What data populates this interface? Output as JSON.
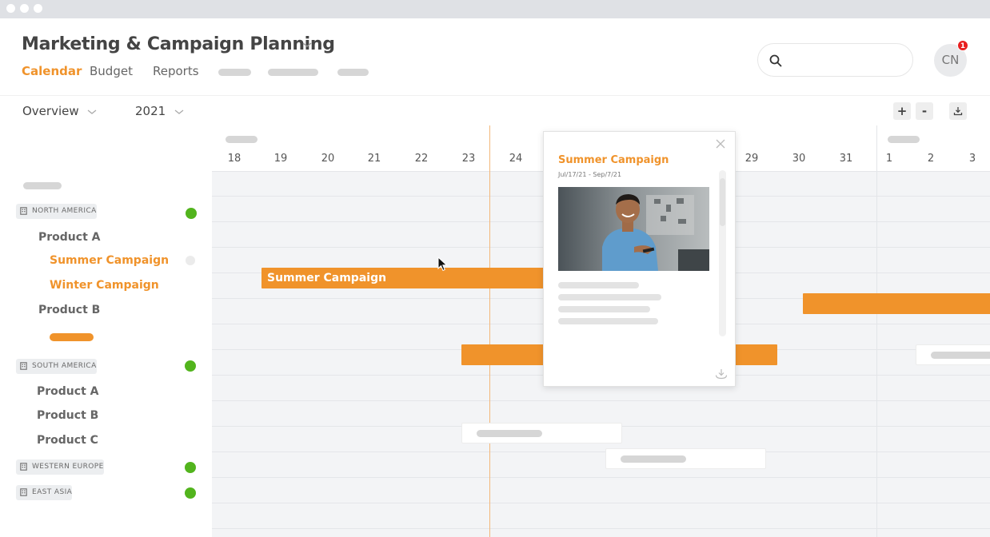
{
  "app": {
    "title": "Marketing & Campaign Planning",
    "accent_color": "#f0932b",
    "success_color": "#52b41d",
    "tabs": [
      {
        "label": "Calendar",
        "active": true
      },
      {
        "label": "Budget",
        "active": false
      },
      {
        "label": "Reports",
        "active": false
      }
    ]
  },
  "search": {
    "placeholder": "",
    "icon": "search-icon"
  },
  "user": {
    "initials": "CN",
    "notification_count": "1"
  },
  "toolbar": {
    "view": "Overview",
    "year": "2021",
    "zoom_in_label": "+",
    "zoom_out_label": "-",
    "export_icon": "download-icon"
  },
  "timeline": {
    "days": [
      "18",
      "19",
      "20",
      "21",
      "22",
      "23",
      "24",
      "29",
      "30",
      "31",
      "1",
      "2",
      "3"
    ]
  },
  "sidebar": {
    "regions": [
      {
        "name": "NORTH AMERICA",
        "status": "green"
      },
      {
        "name": "SOUTH AMERICA",
        "status": "green"
      },
      {
        "name": "WESTERN EUROPE",
        "status": "green"
      },
      {
        "name": "EAST ASIA",
        "status": "green"
      }
    ],
    "north_america": {
      "products": [
        "Product A",
        "Product B"
      ],
      "campaigns": [
        "Summer Campaign",
        "Winter Campaign"
      ]
    },
    "south_america": {
      "products": [
        "Product A",
        "Product B",
        "Product C"
      ]
    }
  },
  "bars": {
    "summer_campaign_label": "Summer Campaign"
  },
  "popup": {
    "title": "Summer Campaign",
    "dates": "Jul/17/21 - Sep/7/21",
    "image": "smiling man in blue shirt looking at phone"
  }
}
